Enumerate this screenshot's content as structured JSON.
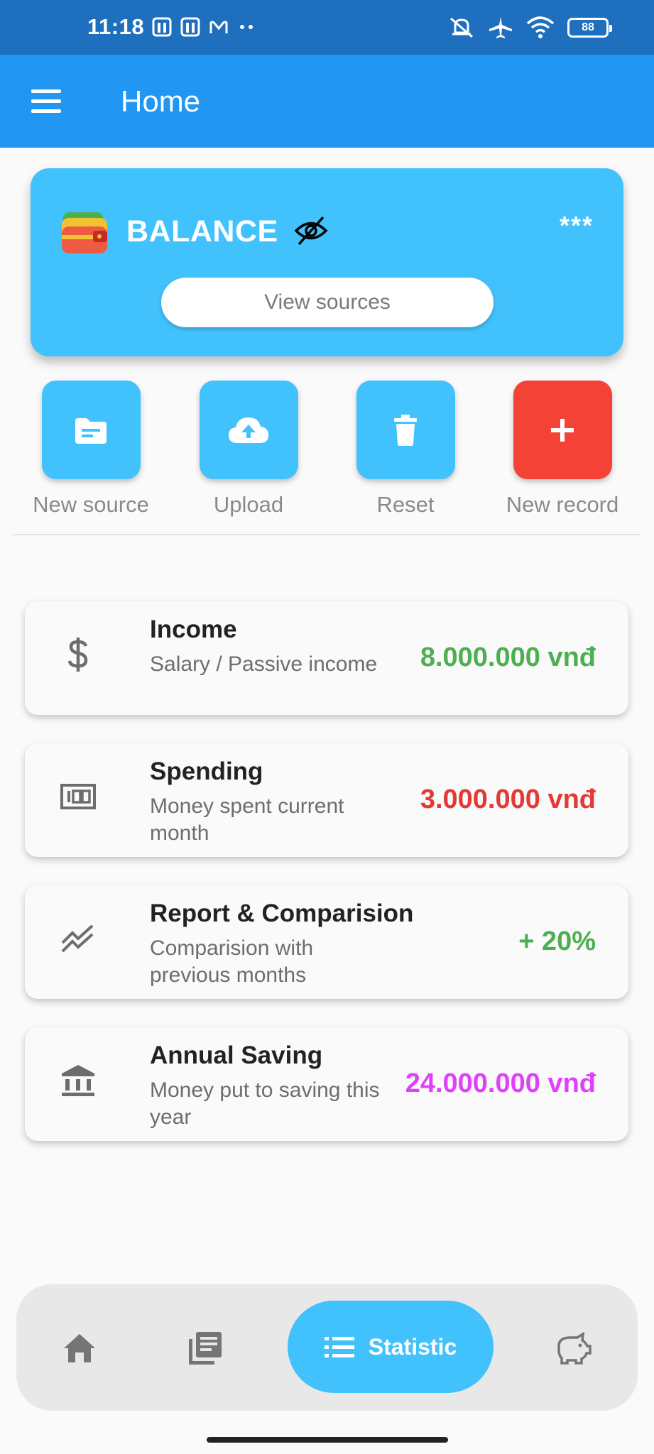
{
  "status_bar": {
    "time": "11:18",
    "battery": "88"
  },
  "app_bar": {
    "title": "Home"
  },
  "balance": {
    "label": "BALANCE",
    "value": "***",
    "view_sources_label": "View sources"
  },
  "actions": [
    {
      "label": "New source",
      "icon": "folder-icon"
    },
    {
      "label": "Upload",
      "icon": "cloud-upload-icon"
    },
    {
      "label": "Reset",
      "icon": "trash-icon"
    },
    {
      "label": "New record",
      "icon": "plus-icon"
    }
  ],
  "stats": [
    {
      "title": "Income",
      "subtitle": "Salary / Passive income",
      "value": "8.000.000 vnđ",
      "color": "#4caf50",
      "icon": "dollar-icon"
    },
    {
      "title": "Spending",
      "subtitle": "Money spent current month",
      "value": "3.000.000 vnđ",
      "color": "#e53935",
      "icon": "money-icon"
    },
    {
      "title": "Report & Comparision",
      "subtitle": "Comparision with previous months",
      "value": "+ 20%",
      "color": "#4caf50",
      "icon": "trend-icon"
    },
    {
      "title": "Annual Saving",
      "subtitle": "Money put to saving this year",
      "value": "24.000.000 vnđ",
      "color": "#e040fb",
      "icon": "bank-icon"
    }
  ],
  "bottom_nav": {
    "active_label": "Statistic"
  },
  "colors": {
    "primary": "#2196f3",
    "accent": "#42c2fc",
    "danger": "#f44336"
  }
}
